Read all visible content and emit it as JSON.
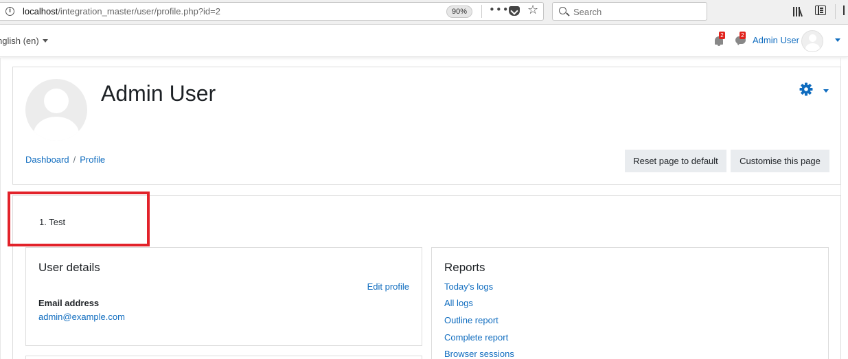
{
  "browser": {
    "url_host": "localhost",
    "url_path": "/integration_master/user/profile.php?id=2",
    "zoom": "90%",
    "search_placeholder": "Search",
    "icons": [
      "info-icon",
      "more-icon",
      "pocket-icon",
      "bookmark-star-icon",
      "search-icon",
      "library-icon",
      "sidebar-icon",
      "menu-icon"
    ]
  },
  "navbar": {
    "language": "nglish (en)",
    "notifications_count": "2",
    "messages_count": "2",
    "user_name": "Admin User"
  },
  "header": {
    "title": "Admin User",
    "breadcrumb": [
      "Dashboard",
      "Profile"
    ],
    "breadcrumb_separator": "/",
    "reset_button": "Reset page to default",
    "customise_button": "Customise this page"
  },
  "content": {
    "list_number": "1.",
    "list_item": "Test",
    "highlight_color": "#e2222a"
  },
  "user_details": {
    "title": "User details",
    "edit_link": "Edit profile",
    "email_label": "Email address",
    "email_value": "admin@example.com"
  },
  "reports": {
    "title": "Reports",
    "links": [
      "Today's logs",
      "All logs",
      "Outline report",
      "Complete report",
      "Browser sessions"
    ]
  },
  "colors": {
    "link": "#0f6cbf",
    "badge": "#e1221c",
    "button_bg": "#e9ecef"
  }
}
